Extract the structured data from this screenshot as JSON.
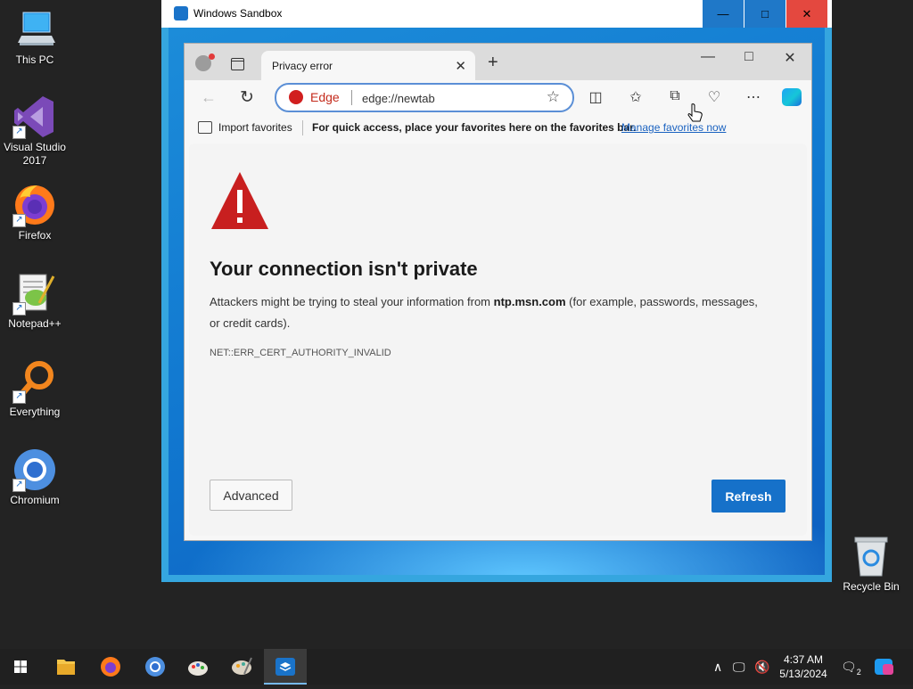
{
  "desktop": {
    "icons": [
      {
        "label": "This PC"
      },
      {
        "label": "Visual Studio 2017"
      },
      {
        "label": "Firefox"
      },
      {
        "label": "Notepad++"
      },
      {
        "label": "Everything"
      },
      {
        "label": "Chromium"
      }
    ],
    "recycle_bin": "Recycle Bin"
  },
  "sandbox": {
    "title": "Windows Sandbox",
    "minimize": "—",
    "maximize": "□",
    "close": "✕"
  },
  "browser": {
    "tab_title": "Privacy error",
    "tab_close": "✕",
    "new_tab": "+",
    "window_controls": {
      "minimize": "—",
      "maximize": "□",
      "close": "✕"
    },
    "address_label": "Edge",
    "address_value": "edge://newtab",
    "favorites_bar": {
      "import": "Import favorites",
      "quick": "For quick access, place your favorites here on the favorites bar.",
      "manage": "Manage favorites now"
    },
    "icons": [
      "back-icon",
      "reload-icon",
      "favorite-star-icon",
      "split-screen-icon",
      "favorites-icon",
      "collections-icon",
      "browser-essentials-icon",
      "more-icon",
      "copilot-icon"
    ]
  },
  "error_page": {
    "heading": "Your connection isn't private",
    "desc_before": "Attackers might be trying to steal your information from ",
    "desc_host": "ntp.msn.com",
    "desc_after": " (for example, passwords, messages, or credit cards).",
    "error_code": "NET::ERR_CERT_AUTHORITY_INVALID",
    "advanced": "Advanced",
    "refresh": "Refresh"
  },
  "taskbar": {
    "time": "4:37 AM",
    "date": "5/13/2024",
    "notifications": "2"
  },
  "colors": {
    "accent": "#1671c9",
    "warning": "#c81f1f",
    "sandbox_frame": "#35a6df"
  }
}
